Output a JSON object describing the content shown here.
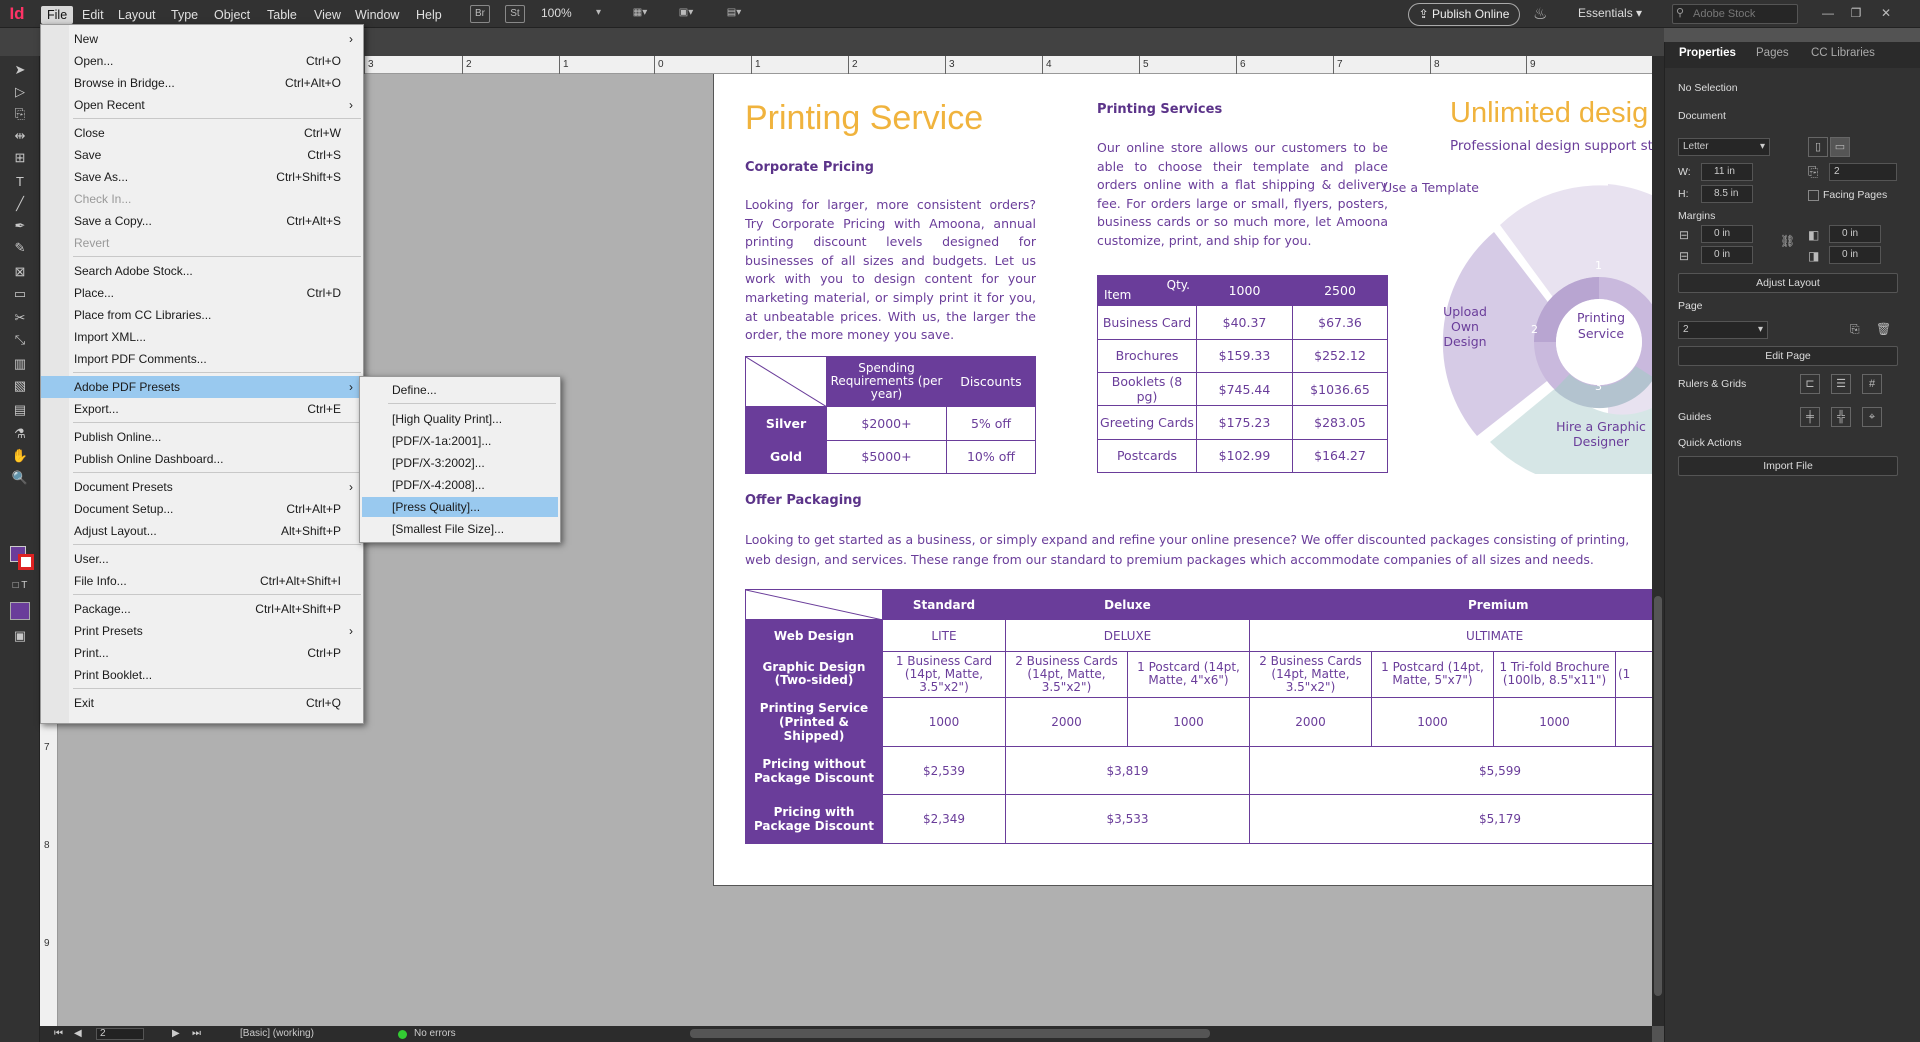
{
  "app": {
    "logo": "Id"
  },
  "menubar": {
    "items": [
      "File",
      "Edit",
      "Layout",
      "Type",
      "Object",
      "Table",
      "View",
      "Window",
      "Help"
    ],
    "bridge": "Br",
    "stock": "St",
    "zoom": "100%",
    "publish_online": "Publish Online",
    "workspace": "Essentials",
    "search_placeholder": "Adobe Stock"
  },
  "file_menu": {
    "items": [
      {
        "label": "New",
        "shortcut": "",
        "submenu": true
      },
      {
        "label": "Open...",
        "shortcut": "Ctrl+O"
      },
      {
        "label": "Browse in Bridge...",
        "shortcut": "Ctrl+Alt+O"
      },
      {
        "label": "Open Recent",
        "shortcut": "",
        "submenu": true
      },
      {
        "label": "Close",
        "shortcut": "Ctrl+W"
      },
      {
        "label": "Save",
        "shortcut": "Ctrl+S"
      },
      {
        "label": "Save As...",
        "shortcut": "Ctrl+Shift+S"
      },
      {
        "label": "Check In...",
        "shortcut": "",
        "disabled": true
      },
      {
        "label": "Save a Copy...",
        "shortcut": "Ctrl+Alt+S"
      },
      {
        "label": "Revert",
        "shortcut": "",
        "disabled": true
      },
      {
        "label": "Search Adobe Stock...",
        "shortcut": ""
      },
      {
        "label": "Place...",
        "shortcut": "Ctrl+D"
      },
      {
        "label": "Place from CC Libraries...",
        "shortcut": ""
      },
      {
        "label": "Import XML...",
        "shortcut": ""
      },
      {
        "label": "Import PDF Comments...",
        "shortcut": ""
      },
      {
        "label": "Adobe PDF Presets",
        "shortcut": "",
        "submenu": true,
        "highlighted": true
      },
      {
        "label": "Export...",
        "shortcut": "Ctrl+E"
      },
      {
        "label": "Publish Online...",
        "shortcut": ""
      },
      {
        "label": "Publish Online Dashboard...",
        "shortcut": ""
      },
      {
        "label": "Document Presets",
        "shortcut": "",
        "submenu": true
      },
      {
        "label": "Document Setup...",
        "shortcut": "Ctrl+Alt+P"
      },
      {
        "label": "Adjust Layout...",
        "shortcut": "Alt+Shift+P"
      },
      {
        "label": "User...",
        "shortcut": ""
      },
      {
        "label": "File Info...",
        "shortcut": "Ctrl+Alt+Shift+I"
      },
      {
        "label": "Package...",
        "shortcut": "Ctrl+Alt+Shift+P"
      },
      {
        "label": "Print Presets",
        "shortcut": "",
        "submenu": true
      },
      {
        "label": "Print...",
        "shortcut": "Ctrl+P"
      },
      {
        "label": "Print Booklet...",
        "shortcut": ""
      },
      {
        "label": "Exit",
        "shortcut": "Ctrl+Q"
      }
    ]
  },
  "pdf_presets_submenu": {
    "items": [
      "Define...",
      "[High Quality Print]...",
      "[PDF/X-1a:2001]...",
      "[PDF/X-3:2002]...",
      "[PDF/X-4:2008]...",
      "[Press Quality]...",
      "[Smallest File Size]..."
    ],
    "highlighted": "[Press Quality]..."
  },
  "ruler_h": [
    "3",
    "2",
    "1",
    "0",
    "1",
    "2",
    "3",
    "4",
    "5",
    "6",
    "7",
    "8",
    "9"
  ],
  "ruler_v": [
    "7",
    "8",
    "9"
  ],
  "document": {
    "title": "Printing Service",
    "corporate_heading": "Corporate Pricing",
    "corporate_text": "Looking for larger, more consistent orders? Try Corporate Pricing with Amoona, annual printing discount levels designed for businesses of all sizes and budgets. Let us work with you to design content for your marketing material, or simply print it for you, at unbeatable prices. With us, the larger the order, the more money you save.",
    "corporate_table": {
      "headers": [
        "Spending Requirements (per year)",
        "Discounts"
      ],
      "rows": [
        {
          "tier": "Silver",
          "spend": "$2000+",
          "discount": "5% off"
        },
        {
          "tier": "Gold",
          "spend": "$5000+",
          "discount": "10% off"
        }
      ]
    },
    "services_heading": "Printing Services",
    "services_text": "Our online store allows our customers to be able to choose their template and place orders online with a flat shipping & delivery fee. For orders large or small, flyers, posters, business cards or so much more, let Amoona customize, print, and ship for you.",
    "services_table": {
      "corner_item": "Item",
      "corner_qty": "Qty.",
      "headers": [
        "1000",
        "2500"
      ],
      "rows": [
        {
          "item": "Business Card",
          "q1000": "$40.37",
          "q2500": "$67.36"
        },
        {
          "item": "Brochures",
          "q1000": "$159.33",
          "q2500": "$252.12"
        },
        {
          "item": "Booklets (8 pg)",
          "q1000": "$745.44",
          "q2500": "$1036.65"
        },
        {
          "item": "Greeting Cards",
          "q1000": "$175.23",
          "q2500": "$283.05"
        },
        {
          "item": "Postcards",
          "q1000": "$102.99",
          "q2500": "$164.27"
        }
      ]
    },
    "design_title": "Unlimited desig",
    "design_subtitle": "Professional design support star",
    "donut": {
      "center": "Printing Service",
      "segments": [
        "Use a Template",
        "Upload Own Design",
        "Hire a Graphic Designer"
      ],
      "numbers": [
        "1",
        "2",
        "3"
      ],
      "colors": {
        "light": "#e8e2f0",
        "mid": "#d6cbe6",
        "dark": "#b8a5d1",
        "teal": "#d6e6e6",
        "ring": "#c9b9dd"
      }
    },
    "offer_heading": "Offer Packaging",
    "offer_text": "Looking to get started as a business, or simply expand and refine your online presence? We offer discounted packages consisting of printing, web design, and services. These range from our standard to premium packages which accommodate companies of all sizes and needs.",
    "packages_table": {
      "headers": [
        "Standard",
        "Deluxe",
        "Premium"
      ],
      "row_labels": [
        "Web Design",
        "Graphic Design (Two-sided)",
        "Printing Service (Printed & Shipped)",
        "Pricing without Package Discount",
        "Pricing with Package Discount"
      ],
      "web_design": [
        "LITE",
        "DELUXE",
        "ULTIMATE"
      ],
      "graphic_design": [
        "1 Business Card (14pt, Matte, 3.5\"x2\")",
        "2 Business Cards (14pt, Matte, 3.5\"x2\")",
        "1 Postcard (14pt, Matte, 4\"x6\")",
        "2 Business Cards (14pt, Matte, 3.5\"x2\")",
        "1 Postcard (14pt, Matte, 5\"x7\")",
        "1 Tri-fold Brochure (100lb, 8.5\"x11\")",
        "(1"
      ],
      "printing": [
        "1000",
        "2000",
        "1000",
        "2000",
        "1000",
        "1000"
      ],
      "pricing_without": [
        "$2,539",
        "$3,819",
        "$5,599"
      ],
      "pricing_with": [
        "$2,349",
        "$3,533",
        "$5,179"
      ]
    }
  },
  "statusbar": {
    "page": "2",
    "style": "[Basic] (working)",
    "errors": "No errors"
  },
  "panel": {
    "tabs": [
      "Properties",
      "Pages",
      "CC Libraries"
    ],
    "no_selection": "No Selection",
    "document_label": "Document",
    "preset": "Letter",
    "width_label": "W:",
    "width": "11 in",
    "height_label": "H:",
    "height": "8.5 in",
    "pages": "2",
    "facing_pages": "Facing Pages",
    "margins_label": "Margins",
    "margin_values": [
      "0 in",
      "0 in",
      "0 in",
      "0 in"
    ],
    "adjust_layout": "Adjust Layout",
    "page_label": "Page",
    "page_value": "2",
    "edit_page": "Edit Page",
    "rulers_grids": "Rulers & Grids",
    "guides": "Guides",
    "quick_actions": "Quick Actions",
    "import_file": "Import File"
  },
  "colors": {
    "accent": "#6a3d9a",
    "gold": "#f0b33d",
    "menu_highlight": "#99c9ef"
  }
}
